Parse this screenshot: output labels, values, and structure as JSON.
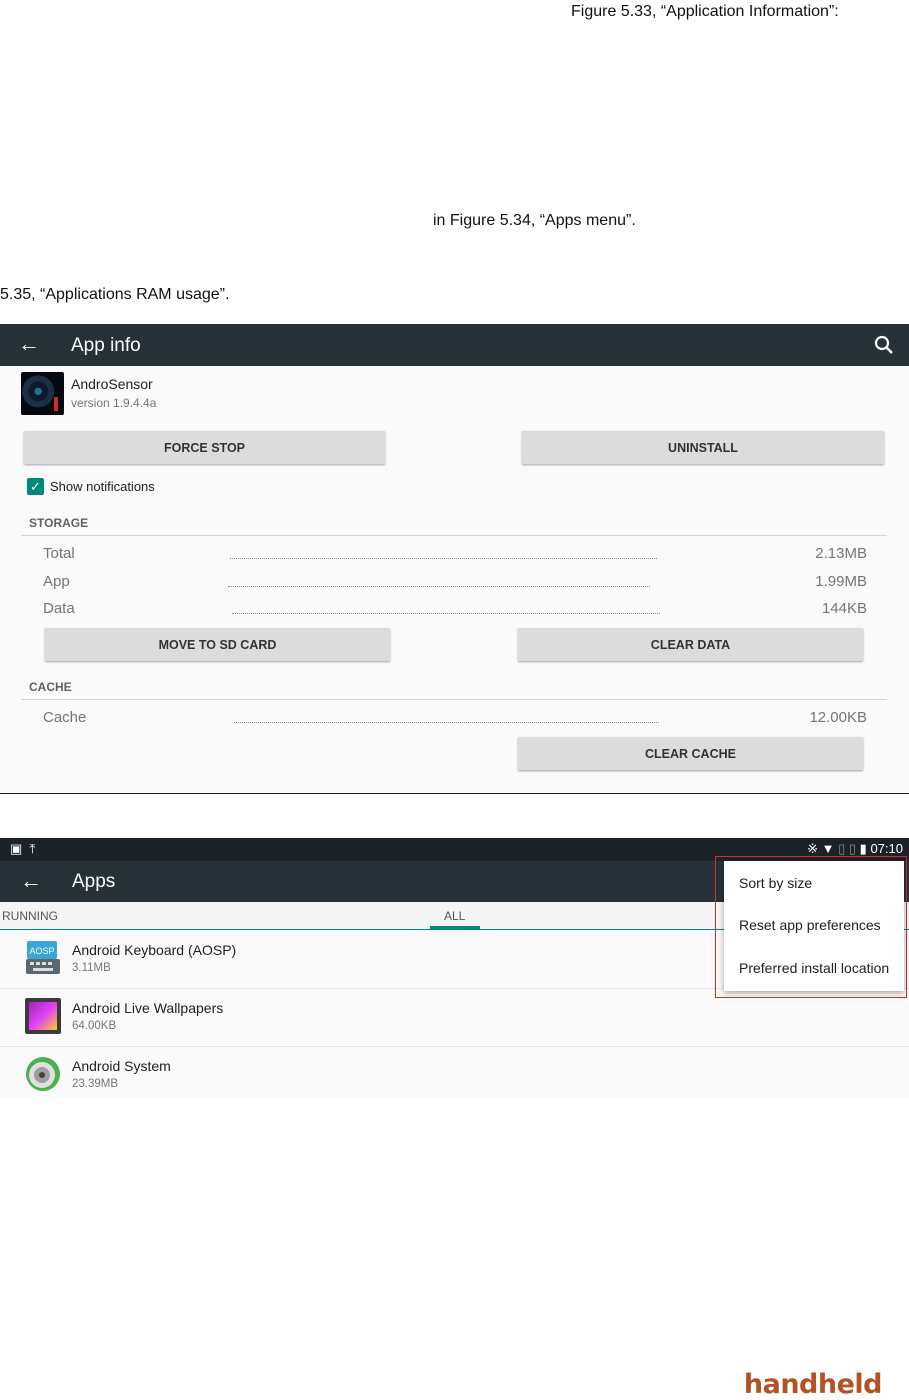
{
  "doc": {
    "line1": "Figure 5.33, “Application Information”:",
    "line2": "in Figure 5.34, “Apps menu”.",
    "line3": "5.35, “Applications RAM usage”."
  },
  "app_info": {
    "title": "App info",
    "app_name": "AndroSensor",
    "app_version": "version 1.9.4.4a",
    "force_stop": "FORCE STOP",
    "uninstall": "UNINSTALL",
    "show_notifications": "Show notifications",
    "storage_heading": "STORAGE",
    "storage_rows": [
      {
        "label": "Total",
        "value": "2.13MB"
      },
      {
        "label": "App",
        "value": "1.99MB"
      },
      {
        "label": "Data",
        "value": "144KB"
      }
    ],
    "move_to_sd": "MOVE TO SD CARD",
    "clear_data": "CLEAR DATA",
    "cache_heading": "CACHE",
    "cache_row": {
      "label": "Cache",
      "value": "12.00KB"
    },
    "clear_cache": "CLEAR CACHE",
    "accent": "#00897b",
    "toolbar_color": "#263238"
  },
  "apps_screen": {
    "time": "07:10",
    "title": "Apps",
    "tabs": [
      "RUNNING",
      "ALL"
    ],
    "apps": [
      {
        "name": "Android Keyboard (AOSP)",
        "size": "3.11MB",
        "icon": "keyboard-icon"
      },
      {
        "name": "Android Live Wallpapers",
        "size": "64.00KB",
        "icon": "wallpaper-icon"
      },
      {
        "name": "Android System",
        "size": "23.39MB",
        "icon": "android-system-icon"
      }
    ],
    "menu": [
      "Sort by size",
      "Reset app preferences",
      "Preferred install location"
    ],
    "highlight_color": "#d32f2f"
  },
  "brand": "handheld"
}
